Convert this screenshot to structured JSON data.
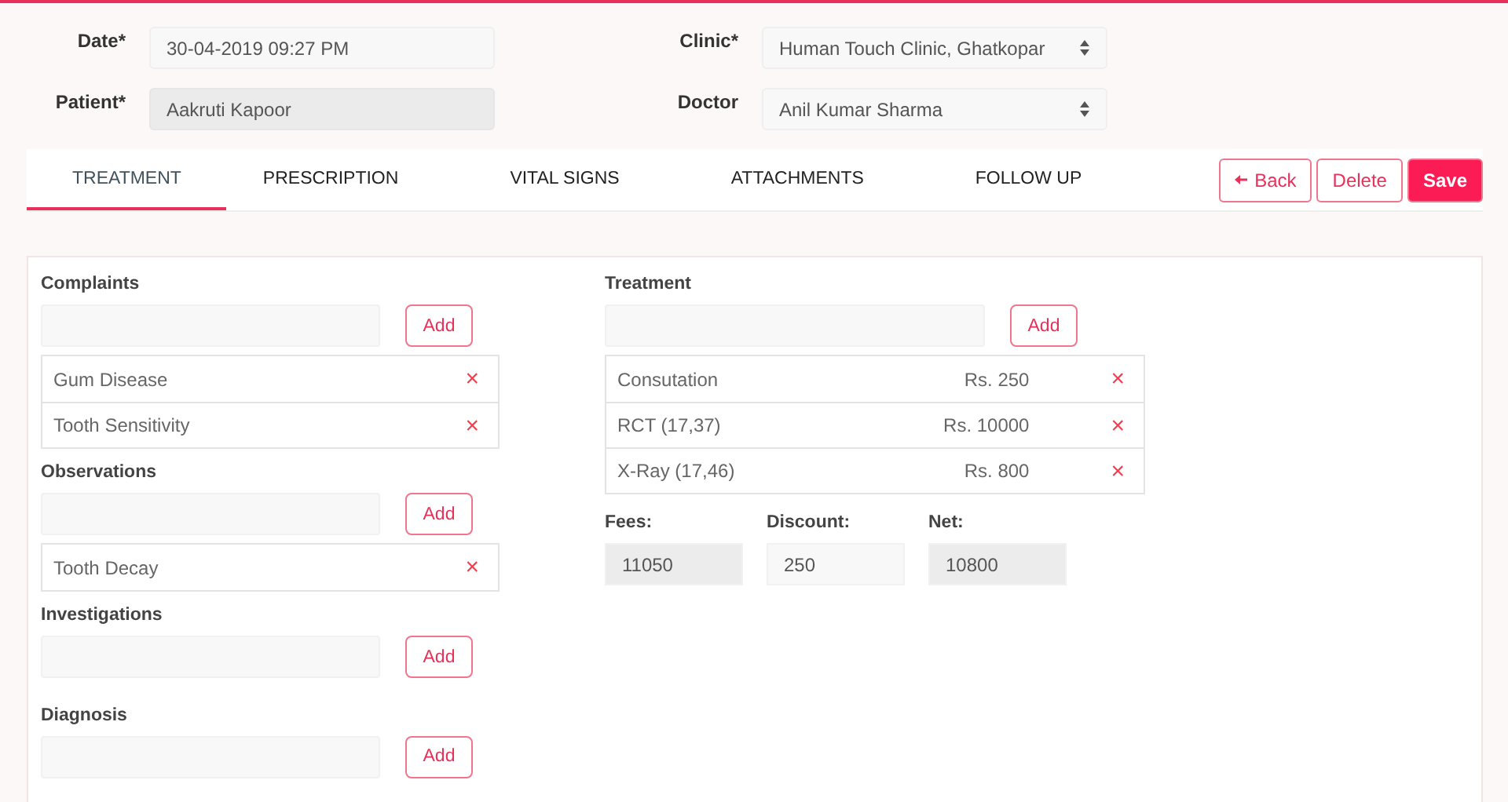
{
  "header": {
    "fields": [
      {
        "label": "Date*",
        "kind": "text",
        "value": "30-04-2019 09:27 PM",
        "disabled": false
      },
      {
        "label": "Clinic*",
        "kind": "select",
        "value": "Human Touch Clinic, Ghatkopar",
        "disabled": false
      },
      {
        "label": "Patient*",
        "kind": "text",
        "value": "Aakruti Kapoor",
        "disabled": true
      },
      {
        "label": "Doctor",
        "kind": "select",
        "value": "Anil Kumar Sharma",
        "disabled": false
      }
    ]
  },
  "tabs": [
    {
      "label": "TREATMENT",
      "selected": true
    },
    {
      "label": "PRESCRIPTION",
      "selected": false
    },
    {
      "label": "VITAL SIGNS",
      "selected": false
    },
    {
      "label": "ATTACHMENTS",
      "selected": false
    },
    {
      "label": "FOLLOW UP",
      "selected": false
    }
  ],
  "actions": [
    {
      "label": "Back",
      "kind": "back"
    },
    {
      "label": "Delete",
      "kind": "outline"
    },
    {
      "label": "Save",
      "kind": "primary"
    }
  ],
  "sections": [
    {
      "label": "Complaints",
      "add": "Add",
      "items": [
        {
          "name": "Gum Disease",
          "remove": "×"
        },
        {
          "name": "Tooth Sensitivity",
          "remove": "×"
        }
      ]
    },
    {
      "label": "Observations",
      "add": "Add",
      "items": [
        {
          "name": "Tooth Decay",
          "remove": "×"
        }
      ]
    },
    {
      "label": "Investigations",
      "add": "Add"
    },
    {
      "label": "Diagnosis",
      "add": "Add"
    }
  ],
  "treatment": {
    "label": "Treatment",
    "add": "Add",
    "items": [
      {
        "name": "Consutation",
        "price": "Rs. 250",
        "remove": "×"
      },
      {
        "name": "RCT (17,37)",
        "price": "Rs. 10000",
        "remove": "×"
      },
      {
        "name": "X-Ray (17,46)",
        "price": "Rs. 800",
        "remove": "×"
      }
    ],
    "totals": [
      {
        "label": "Fees:",
        "value": "11050",
        "disabled": true
      },
      {
        "label": "Discount:",
        "value": "250",
        "disabled": false
      },
      {
        "label": "Net:",
        "value": "10800",
        "disabled": true
      }
    ]
  }
}
